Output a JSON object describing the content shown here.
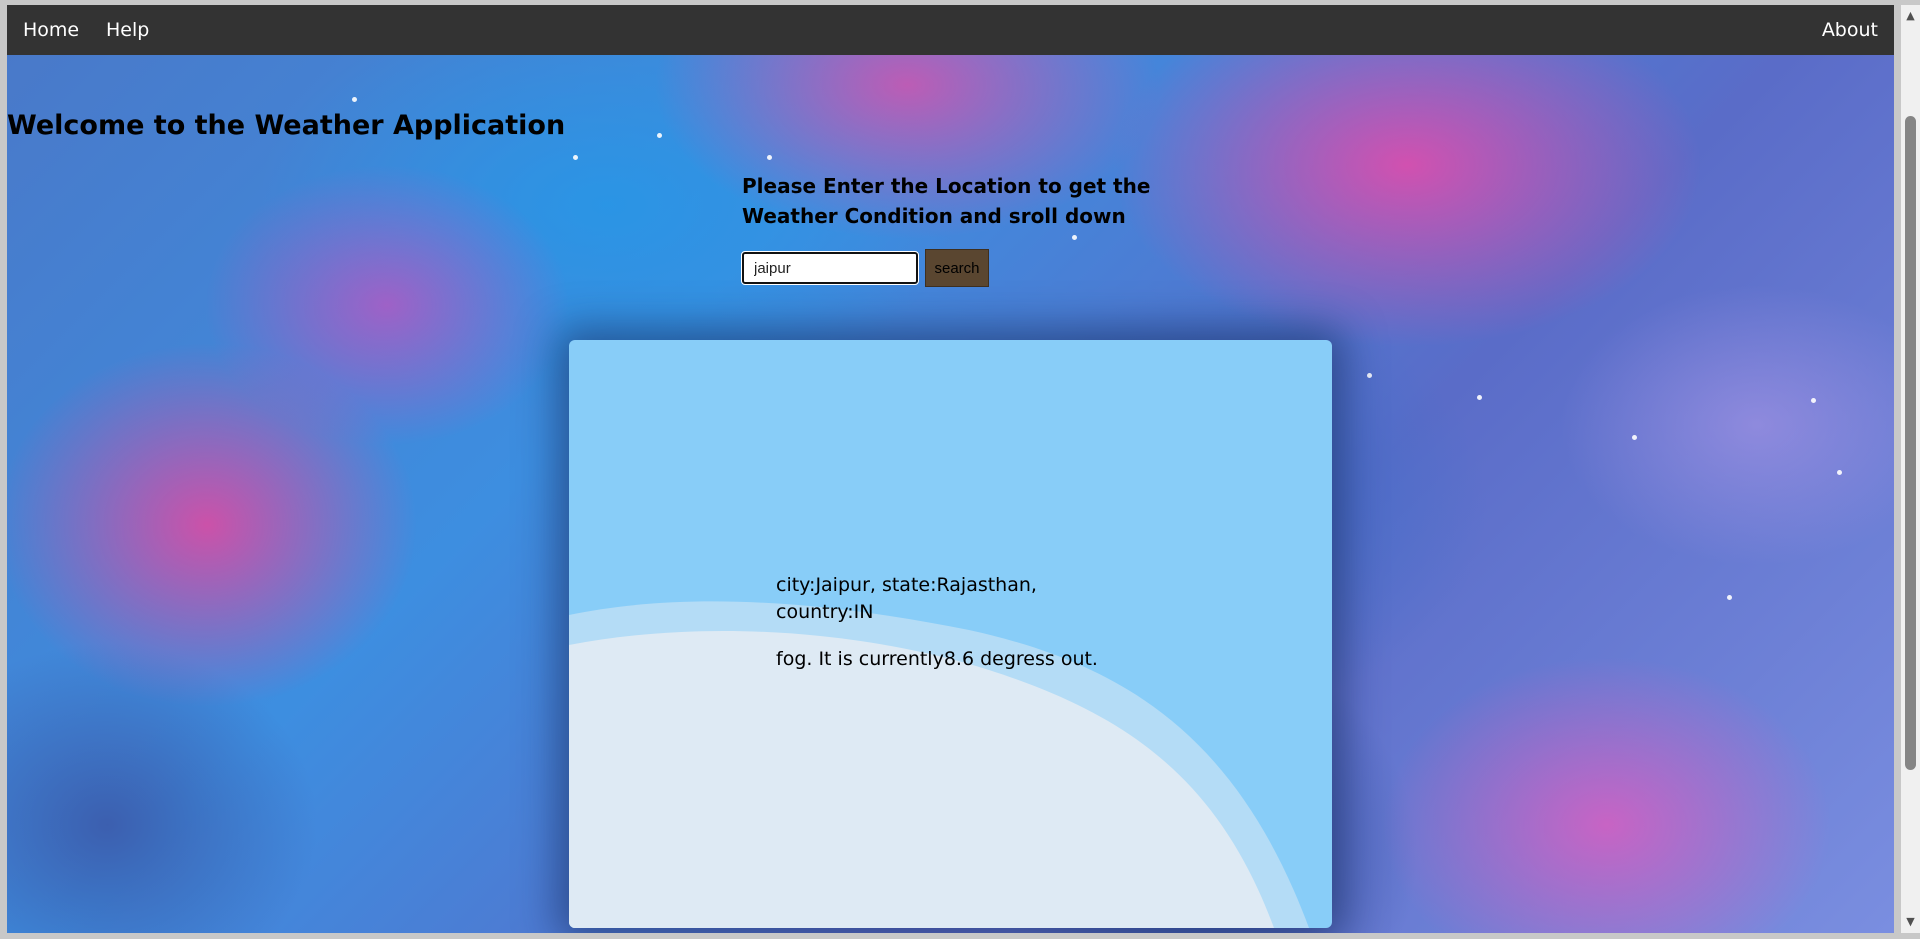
{
  "nav": {
    "home": "Home",
    "help": "Help",
    "about": "About"
  },
  "main": {
    "welcome": "Welcome to the Weather Application",
    "prompt": "Please Enter the Location to get the Weather Condition and sroll down"
  },
  "search": {
    "value": "jaipur",
    "button_label": "search"
  },
  "weather": {
    "location": "city:Jaipur, state:Rajasthan, country:IN",
    "condition": "fog. It is currently8.6 degress out."
  },
  "colors": {
    "navbar": "#333333",
    "card": "#88cdf8",
    "wave": "#deeaf4",
    "search_button": "#5a4630"
  },
  "icons": {
    "scroll_up": "triangle-up",
    "scroll_down": "triangle-down"
  }
}
